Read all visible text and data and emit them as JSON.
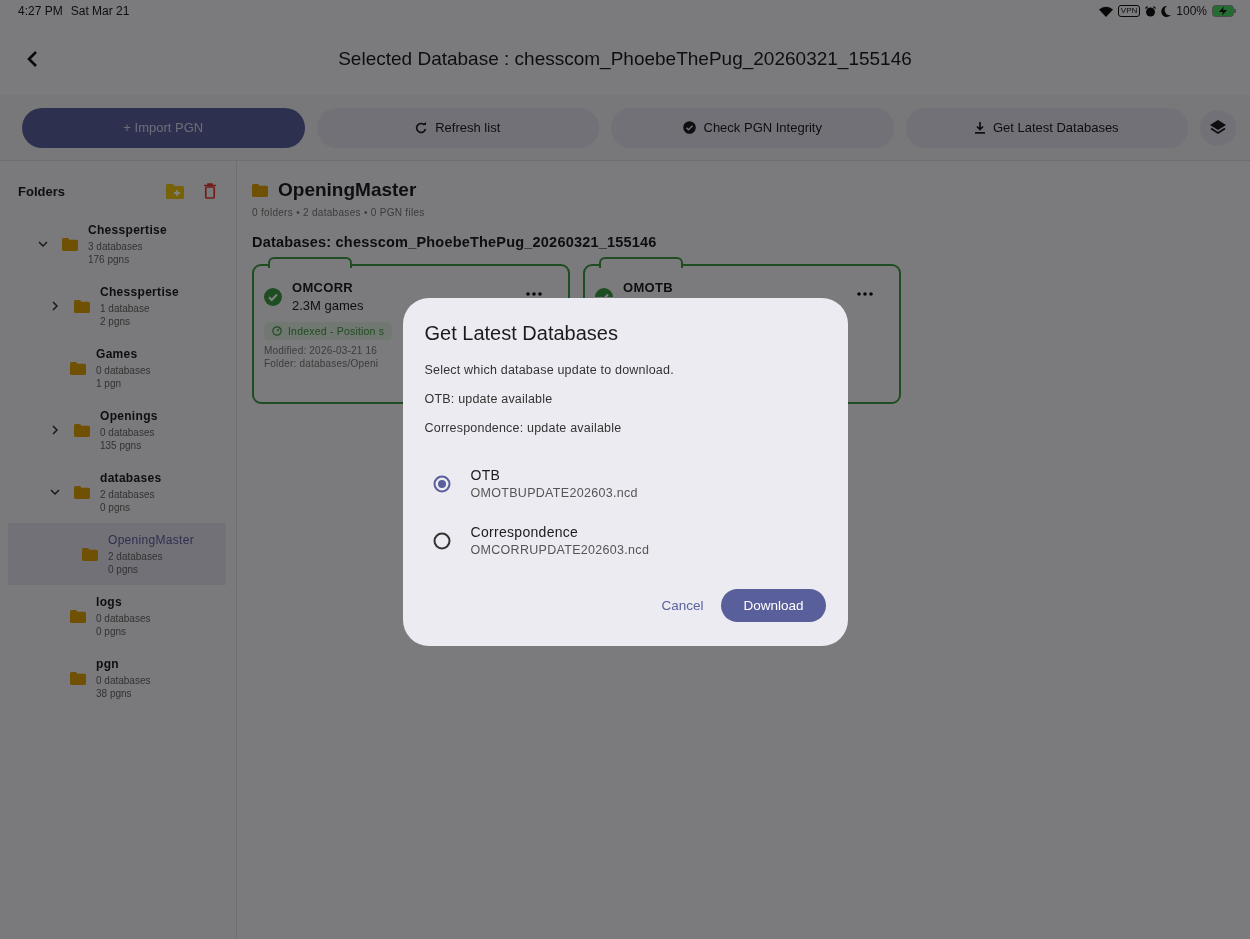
{
  "status_bar": {
    "time": "4:27 PM",
    "date": "Sat Mar 21",
    "vpn": "VPN",
    "battery": "100%"
  },
  "header": {
    "title": "Selected Database : chesscom_PhoebeThePug_20260321_155146"
  },
  "toolbar": [
    {
      "kind": "primary",
      "label": "+ Import PGN"
    },
    {
      "kind": "tonal",
      "label": "Refresh list"
    },
    {
      "kind": "tonal",
      "label": "Check PGN Integrity"
    },
    {
      "kind": "tonal",
      "label": "Get Latest Databases"
    }
  ],
  "sidebar": {
    "title": "Folders",
    "items": [
      {
        "name": "Chesspertise",
        "databases": "3 databases",
        "pgns": "176 pgns",
        "selected": false,
        "expanded": true,
        "children": [
          {
            "name": "Chesspertise",
            "databases": "1 database",
            "pgns": "2 pgns",
            "selected": false,
            "expanded": false
          },
          {
            "name": "Games",
            "databases": "0 databases",
            "pgns": "1 pgn",
            "selected": false
          },
          {
            "name": "Openings",
            "databases": "0 databases",
            "pgns": "135 pgns",
            "selected": false,
            "expanded": false
          },
          {
            "name": "databases",
            "databases": "2 databases",
            "pgns": "0 pgns",
            "selected": false,
            "expanded": true,
            "children": [
              {
                "name": "OpeningMaster",
                "databases": "2 databases",
                "pgns": "0 pgns",
                "selected": true
              }
            ]
          },
          {
            "name": "logs",
            "databases": "0 databases",
            "pgns": "0 pgns",
            "selected": false
          },
          {
            "name": "pgn",
            "databases": "0 databases",
            "pgns": "38 pgns",
            "selected": false
          }
        ]
      }
    ]
  },
  "main": {
    "folder_title": "OpeningMaster",
    "summary": "0 folders • 2 databases • 0 PGN files",
    "section_title": "Databases: chesscom_PhoebeThePug_20260321_155146",
    "cards": [
      {
        "name": "OMCORR",
        "games": "2.3M games",
        "status": "Indexed - Position s",
        "modified": "Modified: 2026-03-21 16",
        "folder": "Folder: databases/Openi"
      },
      {
        "name": "OMOTB"
      }
    ]
  },
  "dialog": {
    "title": "Get Latest Databases",
    "prompt": "Select which database update to download.",
    "notes": [
      "OTB: update available",
      "Correspondence: update available"
    ],
    "options": [
      {
        "label": "OTB",
        "file": "OMOTBUPDATE202603.ncd",
        "selected": true
      },
      {
        "label": "Correspondence",
        "file": "OMCORRUPDATE202603.ncd",
        "selected": false
      }
    ],
    "cancel": "Cancel",
    "confirm": "Download"
  }
}
